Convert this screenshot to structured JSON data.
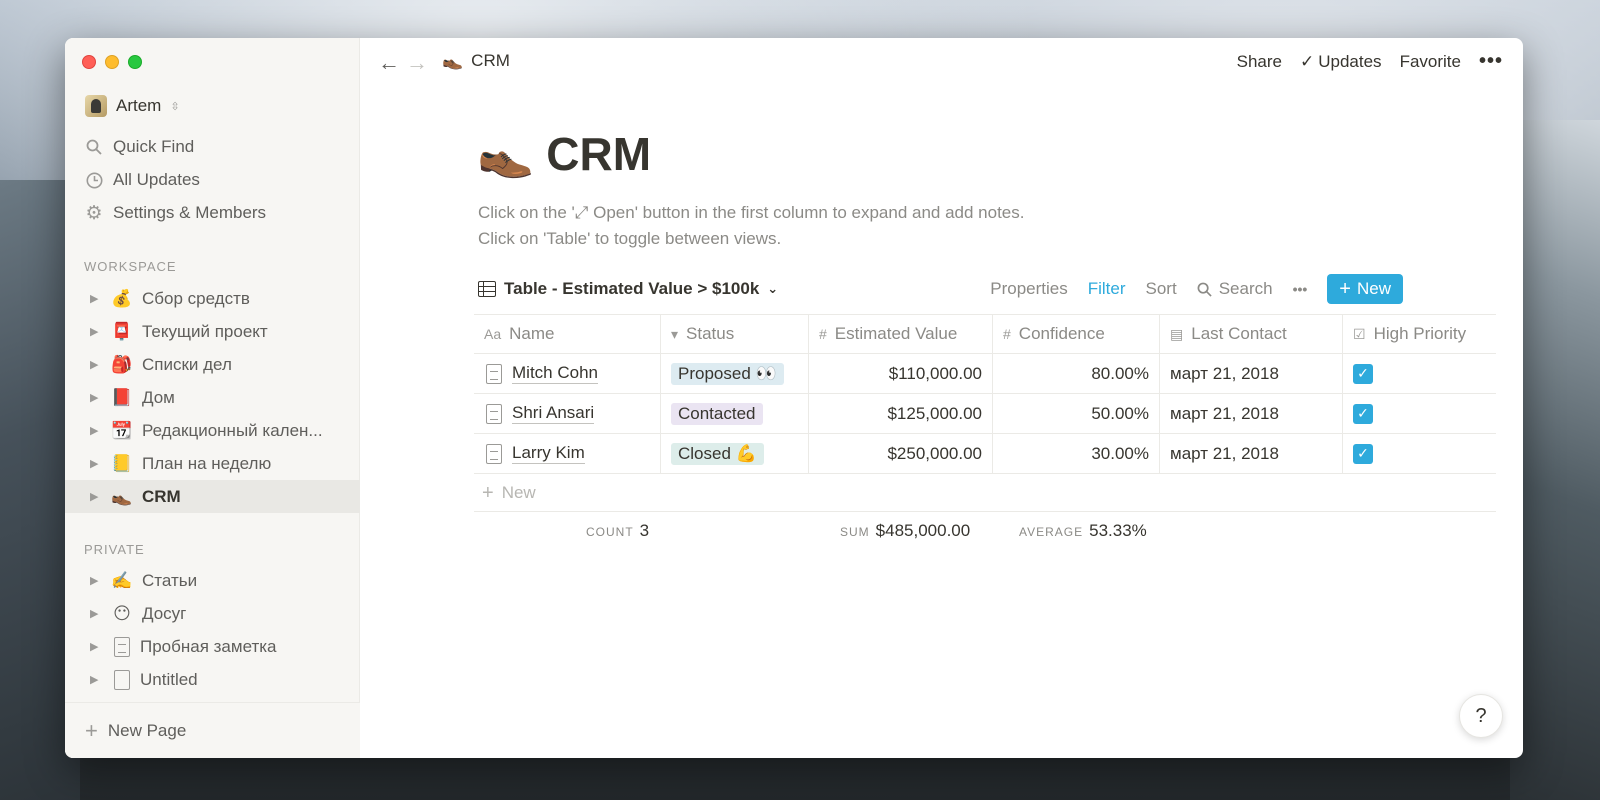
{
  "sidebar": {
    "user_name": "Artem",
    "nav": [
      {
        "label": "Quick Find",
        "icon": "search-icon"
      },
      {
        "label": "All Updates",
        "icon": "clock-icon"
      },
      {
        "label": "Settings & Members",
        "icon": "gear-icon"
      }
    ],
    "workspace_label": "WORKSPACE",
    "workspace_pages": [
      {
        "emoji": "💰",
        "label": "Сбор средств"
      },
      {
        "emoji": "📮",
        "label": "Текущий проект"
      },
      {
        "emoji": "🎒",
        "label": "Списки дел"
      },
      {
        "emoji": "📕",
        "label": "Дом"
      },
      {
        "emoji": "📆",
        "label": "Редакционный кален..."
      },
      {
        "emoji": "📒",
        "label": "План на неделю"
      },
      {
        "emoji": "👞",
        "label": "CRM"
      }
    ],
    "private_label": "PRIVATE",
    "private_pages": [
      {
        "emoji": "✍️",
        "label": "Статьи"
      },
      {
        "emoji": "😶",
        "label": "Досуг"
      },
      {
        "emoji": "",
        "label": "Пробная заметка"
      },
      {
        "emoji": "",
        "label": "Untitled"
      }
    ],
    "new_page_label": "New Page"
  },
  "topbar": {
    "breadcrumb_emoji": "👞",
    "breadcrumb": "CRM",
    "share": "Share",
    "updates": "Updates",
    "favorite": "Favorite",
    "more": "•••"
  },
  "page": {
    "emoji": "👞",
    "title": "CRM",
    "description_line1": "Click on the '⤢ Open' button in the first column to expand and add notes.",
    "description_line2": "Click on 'Table' to toggle between views."
  },
  "view": {
    "name": "Table - Estimated Value > $100k",
    "properties": "Properties",
    "filter": "Filter",
    "sort": "Sort",
    "search": "Search",
    "more": "•••",
    "new": "New"
  },
  "table": {
    "columns": [
      {
        "label": "Name",
        "icon": "Aa"
      },
      {
        "label": "Status",
        "icon": "▾"
      },
      {
        "label": "Estimated Value",
        "icon": "#"
      },
      {
        "label": "Confidence",
        "icon": "#"
      },
      {
        "label": "Last Contact",
        "icon": "▤"
      },
      {
        "label": "High Priority",
        "icon": "☑"
      }
    ],
    "rows": [
      {
        "name": "Mitch Cohn",
        "status": "Proposed 👀",
        "value": "$110,000.00",
        "confidence": "80.00%",
        "date": "март 21, 2018",
        "priority": true
      },
      {
        "name": "Shri Ansari",
        "status": "Contacted",
        "value": "$125,000.00",
        "confidence": "50.00%",
        "date": "март 21, 2018",
        "priority": true
      },
      {
        "name": "Larry Kim",
        "status": "Closed 💪",
        "value": "$250,000.00",
        "confidence": "30.00%",
        "date": "март 21, 2018",
        "priority": true
      }
    ],
    "new_row": "New",
    "count_label": "COUNT",
    "count_value": "3",
    "sum_label": "SUM",
    "sum_value": "$485,000.00",
    "avg_label": "AVERAGE",
    "avg_value": "53.33%"
  },
  "help": "?"
}
